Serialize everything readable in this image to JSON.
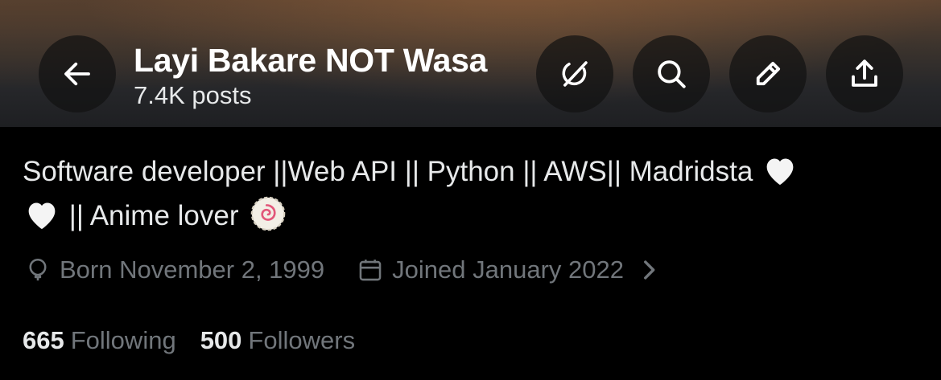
{
  "header": {
    "name": "Layi Bakare NOT Wasa",
    "posts_count": "7.4K posts",
    "buttons": {
      "back": "arrow-left-icon",
      "grok": "grok-icon",
      "search": "search-icon",
      "edit": "pencil-icon",
      "share": "share-upload-icon"
    }
  },
  "bio": {
    "line1": "Software developer ||Web API || Python || AWS|| Madridsta",
    "line2": "|| Anime lover",
    "emojis": [
      "white-heart",
      "white-heart",
      "fish-cake-swirl"
    ]
  },
  "meta": {
    "birth": "Born November 2, 1999",
    "joined": "Joined January 2022"
  },
  "stats": {
    "following_count": "665",
    "following_label": "Following",
    "followers_count": "500",
    "followers_label": "Followers"
  },
  "colors": {
    "background": "#000000",
    "primary_text": "#e7e9ea",
    "secondary_text": "#71767b"
  }
}
